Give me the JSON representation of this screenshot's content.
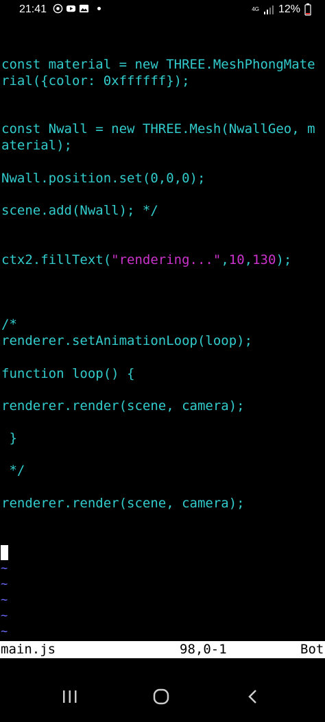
{
  "status_bar": {
    "time": "21:41",
    "network": "4G",
    "battery": "12%"
  },
  "editor": {
    "lines": {
      "l1": "const material = new THREE.MeshPhongMate",
      "l2": "rial({color: 0xffffff});",
      "l3": "const Nwall = new THREE.Mesh(NwallGeo, m",
      "l4": "aterial);",
      "l5": "Nwall.position.set(0,0,0);",
      "l6": "scene.add(Nwall); */",
      "l7a": "ctx2.fillText(",
      "l7b": "\"rendering...\"",
      "l7c": ",",
      "l7d": "10",
      "l7e": ",",
      "l7f": "130",
      "l7g": ");",
      "l8": "/*",
      "l9": "renderer.setAnimationLoop(loop);",
      "l10": "function loop() {",
      "l11": "renderer.render(scene, camera);",
      "l12": " }",
      "l13": " */",
      "l14": "renderer.render(scene, camera);"
    },
    "tilde": "~"
  },
  "vim_status": {
    "filename": "main.js",
    "position": "98,0-1",
    "scroll": "Bot"
  },
  "colors": {
    "code": "#33cccc",
    "string": "#cc33cc",
    "tilde": "#6a6aff"
  }
}
